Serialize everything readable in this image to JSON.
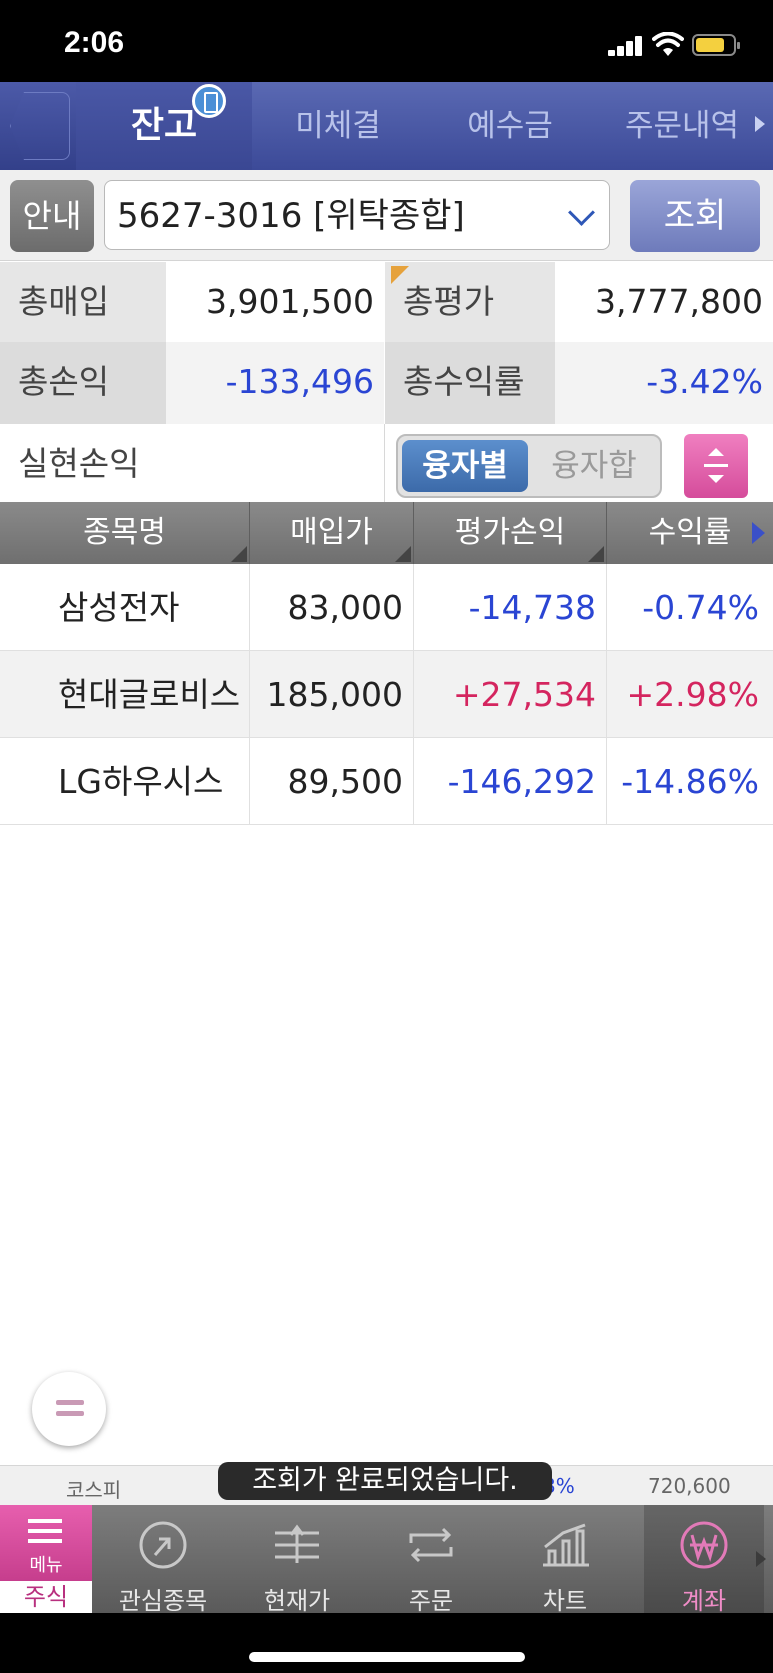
{
  "status_bar": {
    "time": "2:06"
  },
  "tabs": [
    {
      "label": "잔고",
      "active": true
    },
    {
      "label": "미체결",
      "active": false
    },
    {
      "label": "예수금",
      "active": false
    },
    {
      "label": "주문내역",
      "active": false
    }
  ],
  "account": {
    "info_button": "안내",
    "selected": "5627-3016 [위탁종합]",
    "query_button": "조회"
  },
  "summary": {
    "total_purchase_label": "총매입",
    "total_purchase": "3,901,500",
    "total_eval_label": "총평가",
    "total_eval": "3,777,800",
    "total_pl_label": "총손익",
    "total_pl": "-133,496",
    "total_return_label": "총수익률",
    "total_return": "-3.42%",
    "realized_label": "실현손익",
    "realized": "",
    "loan_by": "융자별",
    "loan_sum": "융자합"
  },
  "table": {
    "headers": [
      "종목명",
      "매입가",
      "평가손익",
      "수익률"
    ],
    "rows": [
      {
        "name": "삼성전자",
        "price": "83,000",
        "pl": "-14,738",
        "ret": "-0.74%",
        "sign": "neg"
      },
      {
        "name": "현대글로비스",
        "price": "185,000",
        "pl": "+27,534",
        "ret": "+2.98%",
        "sign": "pos"
      },
      {
        "name": "LG하우시스",
        "price": "89,500",
        "pl": "-146,292",
        "ret": "-14.86%",
        "sign": "neg"
      }
    ]
  },
  "ticker": {
    "index_name": "코스피",
    "change": ".63%",
    "value": "720,600"
  },
  "toast": "조회가 완료되었습니다.",
  "bottom_nav": {
    "menu": "메뉴",
    "stock": "주식",
    "items": [
      "관심종목",
      "현재가",
      "주문",
      "차트",
      "계좌"
    ]
  },
  "colors": {
    "header": "#3c4a98",
    "negative": "#2a45d3",
    "positive": "#d4255f",
    "accent": "#d54c9b"
  }
}
